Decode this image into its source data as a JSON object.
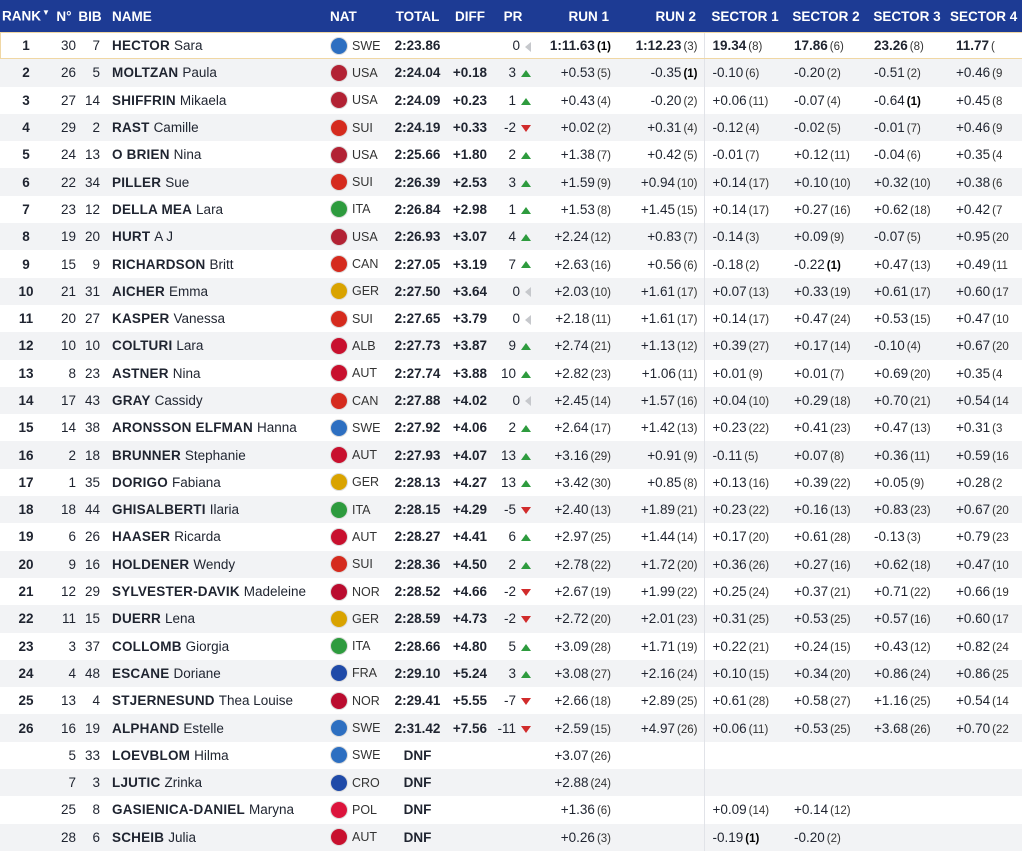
{
  "columns": {
    "rank": "RANK",
    "no": "N°",
    "bib": "BIB",
    "name": "NAME",
    "nat": "NAT",
    "total": "TOTAL",
    "diff": "DIFF",
    "pr": "PR",
    "run1": "RUN 1",
    "run2": "RUN 2",
    "s1": "SECTOR 1",
    "s2": "SECTOR 2",
    "s3": "SECTOR 3",
    "s4": "SECTOR 4"
  },
  "flag_colors": {
    "SWE": "#2d6fc1",
    "USA": "#b22234",
    "SUI": "#d52b1e",
    "CAN": "#d52b1e",
    "ITA": "#2e9b3e",
    "GER": "#d9a300",
    "ALB": "#c8102e",
    "AUT": "#c8102e",
    "NOR": "#ba0c2f",
    "FRA": "#1f4aa8",
    "CRO": "#1f4aa8",
    "POL": "#dc143c"
  },
  "rows": [
    {
      "rank": "1",
      "no": "30",
      "bib": "7",
      "last": "HECTOR",
      "first": "Sara",
      "nat": "SWE",
      "total": "2:23.86",
      "diff": "",
      "pr": "0",
      "dir": "eq",
      "run1": "1:11.63",
      "run1_rk": "(1)",
      "run2": "1:12.23",
      "run2_rk": "(3)",
      "s1": "19.34",
      "s1_rk": "(8)",
      "s2": "17.86",
      "s2_rk": "(6)",
      "s3": "23.26",
      "s3_rk": "(8)",
      "s4": "11.77",
      "s4_rk": "(",
      "leader": true
    },
    {
      "rank": "2",
      "no": "26",
      "bib": "5",
      "last": "MOLTZAN",
      "first": "Paula",
      "nat": "USA",
      "total": "2:24.04",
      "diff": "+0.18",
      "pr": "3",
      "dir": "up",
      "run1": "+0.53",
      "run1_rk": "(5)",
      "run2": "-0.35",
      "run2_rk": "(1)",
      "s1": "-0.10",
      "s1_rk": "(6)",
      "s2": "-0.20",
      "s2_rk": "(2)",
      "s3": "-0.51",
      "s3_rk": "(2)",
      "s4": "+0.46",
      "s4_rk": "(9"
    },
    {
      "rank": "3",
      "no": "27",
      "bib": "14",
      "last": "SHIFFRIN",
      "first": "Mikaela",
      "nat": "USA",
      "total": "2:24.09",
      "diff": "+0.23",
      "pr": "1",
      "dir": "up",
      "run1": "+0.43",
      "run1_rk": "(4)",
      "run2": "-0.20",
      "run2_rk": "(2)",
      "s1": "+0.06",
      "s1_rk": "(11)",
      "s2": "-0.07",
      "s2_rk": "(4)",
      "s3": "-0.64",
      "s3_rk": "(1)",
      "s4": "+0.45",
      "s4_rk": "(8"
    },
    {
      "rank": "4",
      "no": "29",
      "bib": "2",
      "last": "RAST",
      "first": "Camille",
      "nat": "SUI",
      "total": "2:24.19",
      "diff": "+0.33",
      "pr": "-2",
      "dir": "down",
      "run1": "+0.02",
      "run1_rk": "(2)",
      "run2": "+0.31",
      "run2_rk": "(4)",
      "s1": "-0.12",
      "s1_rk": "(4)",
      "s2": "-0.02",
      "s2_rk": "(5)",
      "s3": "-0.01",
      "s3_rk": "(7)",
      "s4": "+0.46",
      "s4_rk": "(9"
    },
    {
      "rank": "5",
      "no": "24",
      "bib": "13",
      "last": "O BRIEN",
      "first": "Nina",
      "nat": "USA",
      "total": "2:25.66",
      "diff": "+1.80",
      "pr": "2",
      "dir": "up",
      "run1": "+1.38",
      "run1_rk": "(7)",
      "run2": "+0.42",
      "run2_rk": "(5)",
      "s1": "-0.01",
      "s1_rk": "(7)",
      "s2": "+0.12",
      "s2_rk": "(11)",
      "s3": "-0.04",
      "s3_rk": "(6)",
      "s4": "+0.35",
      "s4_rk": "(4"
    },
    {
      "rank": "6",
      "no": "22",
      "bib": "34",
      "last": "PILLER",
      "first": "Sue",
      "nat": "SUI",
      "total": "2:26.39",
      "diff": "+2.53",
      "pr": "3",
      "dir": "up",
      "run1": "+1.59",
      "run1_rk": "(9)",
      "run2": "+0.94",
      "run2_rk": "(10)",
      "s1": "+0.14",
      "s1_rk": "(17)",
      "s2": "+0.10",
      "s2_rk": "(10)",
      "s3": "+0.32",
      "s3_rk": "(10)",
      "s4": "+0.38",
      "s4_rk": "(6"
    },
    {
      "rank": "7",
      "no": "23",
      "bib": "12",
      "last": "DELLA MEA",
      "first": "Lara",
      "nat": "ITA",
      "total": "2:26.84",
      "diff": "+2.98",
      "pr": "1",
      "dir": "up",
      "run1": "+1.53",
      "run1_rk": "(8)",
      "run2": "+1.45",
      "run2_rk": "(15)",
      "s1": "+0.14",
      "s1_rk": "(17)",
      "s2": "+0.27",
      "s2_rk": "(16)",
      "s3": "+0.62",
      "s3_rk": "(18)",
      "s4": "+0.42",
      "s4_rk": "(7"
    },
    {
      "rank": "8",
      "no": "19",
      "bib": "20",
      "last": "HURT",
      "first": "A J",
      "nat": "USA",
      "total": "2:26.93",
      "diff": "+3.07",
      "pr": "4",
      "dir": "up",
      "run1": "+2.24",
      "run1_rk": "(12)",
      "run2": "+0.83",
      "run2_rk": "(7)",
      "s1": "-0.14",
      "s1_rk": "(3)",
      "s2": "+0.09",
      "s2_rk": "(9)",
      "s3": "-0.07",
      "s3_rk": "(5)",
      "s4": "+0.95",
      "s4_rk": "(20"
    },
    {
      "rank": "9",
      "no": "15",
      "bib": "9",
      "last": "RICHARDSON",
      "first": "Britt",
      "nat": "CAN",
      "total": "2:27.05",
      "diff": "+3.19",
      "pr": "7",
      "dir": "up",
      "run1": "+2.63",
      "run1_rk": "(16)",
      "run2": "+0.56",
      "run2_rk": "(6)",
      "s1": "-0.18",
      "s1_rk": "(2)",
      "s2": "-0.22",
      "s2_rk": "(1)",
      "s3": "+0.47",
      "s3_rk": "(13)",
      "s4": "+0.49",
      "s4_rk": "(11"
    },
    {
      "rank": "10",
      "no": "21",
      "bib": "31",
      "last": "AICHER",
      "first": "Emma",
      "nat": "GER",
      "total": "2:27.50",
      "diff": "+3.64",
      "pr": "0",
      "dir": "eq",
      "run1": "+2.03",
      "run1_rk": "(10)",
      "run2": "+1.61",
      "run2_rk": "(17)",
      "s1": "+0.07",
      "s1_rk": "(13)",
      "s2": "+0.33",
      "s2_rk": "(19)",
      "s3": "+0.61",
      "s3_rk": "(17)",
      "s4": "+0.60",
      "s4_rk": "(17"
    },
    {
      "rank": "11",
      "no": "20",
      "bib": "27",
      "last": "KASPER",
      "first": "Vanessa",
      "nat": "SUI",
      "total": "2:27.65",
      "diff": "+3.79",
      "pr": "0",
      "dir": "eq",
      "run1": "+2.18",
      "run1_rk": "(11)",
      "run2": "+1.61",
      "run2_rk": "(17)",
      "s1": "+0.14",
      "s1_rk": "(17)",
      "s2": "+0.47",
      "s2_rk": "(24)",
      "s3": "+0.53",
      "s3_rk": "(15)",
      "s4": "+0.47",
      "s4_rk": "(10"
    },
    {
      "rank": "12",
      "no": "10",
      "bib": "10",
      "last": "COLTURI",
      "first": "Lara",
      "nat": "ALB",
      "total": "2:27.73",
      "diff": "+3.87",
      "pr": "9",
      "dir": "up",
      "run1": "+2.74",
      "run1_rk": "(21)",
      "run2": "+1.13",
      "run2_rk": "(12)",
      "s1": "+0.39",
      "s1_rk": "(27)",
      "s2": "+0.17",
      "s2_rk": "(14)",
      "s3": "-0.10",
      "s3_rk": "(4)",
      "s4": "+0.67",
      "s4_rk": "(20"
    },
    {
      "rank": "13",
      "no": "8",
      "bib": "23",
      "last": "ASTNER",
      "first": "Nina",
      "nat": "AUT",
      "total": "2:27.74",
      "diff": "+3.88",
      "pr": "10",
      "dir": "up",
      "run1": "+2.82",
      "run1_rk": "(23)",
      "run2": "+1.06",
      "run2_rk": "(11)",
      "s1": "+0.01",
      "s1_rk": "(9)",
      "s2": "+0.01",
      "s2_rk": "(7)",
      "s3": "+0.69",
      "s3_rk": "(20)",
      "s4": "+0.35",
      "s4_rk": "(4"
    },
    {
      "rank": "14",
      "no": "17",
      "bib": "43",
      "last": "GRAY",
      "first": "Cassidy",
      "nat": "CAN",
      "total": "2:27.88",
      "diff": "+4.02",
      "pr": "0",
      "dir": "eq",
      "run1": "+2.45",
      "run1_rk": "(14)",
      "run2": "+1.57",
      "run2_rk": "(16)",
      "s1": "+0.04",
      "s1_rk": "(10)",
      "s2": "+0.29",
      "s2_rk": "(18)",
      "s3": "+0.70",
      "s3_rk": "(21)",
      "s4": "+0.54",
      "s4_rk": "(14"
    },
    {
      "rank": "15",
      "no": "14",
      "bib": "38",
      "last": "ARONSSON ELFMAN",
      "first": "Hanna",
      "nat": "SWE",
      "total": "2:27.92",
      "diff": "+4.06",
      "pr": "2",
      "dir": "up",
      "run1": "+2.64",
      "run1_rk": "(17)",
      "run2": "+1.42",
      "run2_rk": "(13)",
      "s1": "+0.23",
      "s1_rk": "(22)",
      "s2": "+0.41",
      "s2_rk": "(23)",
      "s3": "+0.47",
      "s3_rk": "(13)",
      "s4": "+0.31",
      "s4_rk": "(3"
    },
    {
      "rank": "16",
      "no": "2",
      "bib": "18",
      "last": "BRUNNER",
      "first": "Stephanie",
      "nat": "AUT",
      "total": "2:27.93",
      "diff": "+4.07",
      "pr": "13",
      "dir": "up",
      "run1": "+3.16",
      "run1_rk": "(29)",
      "run2": "+0.91",
      "run2_rk": "(9)",
      "s1": "-0.11",
      "s1_rk": "(5)",
      "s2": "+0.07",
      "s2_rk": "(8)",
      "s3": "+0.36",
      "s3_rk": "(11)",
      "s4": "+0.59",
      "s4_rk": "(16"
    },
    {
      "rank": "17",
      "no": "1",
      "bib": "35",
      "last": "DORIGO",
      "first": "Fabiana",
      "nat": "GER",
      "total": "2:28.13",
      "diff": "+4.27",
      "pr": "13",
      "dir": "up",
      "run1": "+3.42",
      "run1_rk": "(30)",
      "run2": "+0.85",
      "run2_rk": "(8)",
      "s1": "+0.13",
      "s1_rk": "(16)",
      "s2": "+0.39",
      "s2_rk": "(22)",
      "s3": "+0.05",
      "s3_rk": "(9)",
      "s4": "+0.28",
      "s4_rk": "(2"
    },
    {
      "rank": "18",
      "no": "18",
      "bib": "44",
      "last": "GHISALBERTI",
      "first": "Ilaria",
      "nat": "ITA",
      "total": "2:28.15",
      "diff": "+4.29",
      "pr": "-5",
      "dir": "down",
      "run1": "+2.40",
      "run1_rk": "(13)",
      "run2": "+1.89",
      "run2_rk": "(21)",
      "s1": "+0.23",
      "s1_rk": "(22)",
      "s2": "+0.16",
      "s2_rk": "(13)",
      "s3": "+0.83",
      "s3_rk": "(23)",
      "s4": "+0.67",
      "s4_rk": "(20"
    },
    {
      "rank": "19",
      "no": "6",
      "bib": "26",
      "last": "HAASER",
      "first": "Ricarda",
      "nat": "AUT",
      "total": "2:28.27",
      "diff": "+4.41",
      "pr": "6",
      "dir": "up",
      "run1": "+2.97",
      "run1_rk": "(25)",
      "run2": "+1.44",
      "run2_rk": "(14)",
      "s1": "+0.17",
      "s1_rk": "(20)",
      "s2": "+0.61",
      "s2_rk": "(28)",
      "s3": "-0.13",
      "s3_rk": "(3)",
      "s4": "+0.79",
      "s4_rk": "(23"
    },
    {
      "rank": "20",
      "no": "9",
      "bib": "16",
      "last": "HOLDENER",
      "first": "Wendy",
      "nat": "SUI",
      "total": "2:28.36",
      "diff": "+4.50",
      "pr": "2",
      "dir": "up",
      "run1": "+2.78",
      "run1_rk": "(22)",
      "run2": "+1.72",
      "run2_rk": "(20)",
      "s1": "+0.36",
      "s1_rk": "(26)",
      "s2": "+0.27",
      "s2_rk": "(16)",
      "s3": "+0.62",
      "s3_rk": "(18)",
      "s4": "+0.47",
      "s4_rk": "(10"
    },
    {
      "rank": "21",
      "no": "12",
      "bib": "29",
      "last": "SYLVESTER-DAVIK",
      "first": "Madeleine",
      "nat": "NOR",
      "total": "2:28.52",
      "diff": "+4.66",
      "pr": "-2",
      "dir": "down",
      "run1": "+2.67",
      "run1_rk": "(19)",
      "run2": "+1.99",
      "run2_rk": "(22)",
      "s1": "+0.25",
      "s1_rk": "(24)",
      "s2": "+0.37",
      "s2_rk": "(21)",
      "s3": "+0.71",
      "s3_rk": "(22)",
      "s4": "+0.66",
      "s4_rk": "(19"
    },
    {
      "rank": "22",
      "no": "11",
      "bib": "15",
      "last": "DUERR",
      "first": "Lena",
      "nat": "GER",
      "total": "2:28.59",
      "diff": "+4.73",
      "pr": "-2",
      "dir": "down",
      "run1": "+2.72",
      "run1_rk": "(20)",
      "run2": "+2.01",
      "run2_rk": "(23)",
      "s1": "+0.31",
      "s1_rk": "(25)",
      "s2": "+0.53",
      "s2_rk": "(25)",
      "s3": "+0.57",
      "s3_rk": "(16)",
      "s4": "+0.60",
      "s4_rk": "(17"
    },
    {
      "rank": "23",
      "no": "3",
      "bib": "37",
      "last": "COLLOMB",
      "first": "Giorgia",
      "nat": "ITA",
      "total": "2:28.66",
      "diff": "+4.80",
      "pr": "5",
      "dir": "up",
      "run1": "+3.09",
      "run1_rk": "(28)",
      "run2": "+1.71",
      "run2_rk": "(19)",
      "s1": "+0.22",
      "s1_rk": "(21)",
      "s2": "+0.24",
      "s2_rk": "(15)",
      "s3": "+0.43",
      "s3_rk": "(12)",
      "s4": "+0.82",
      "s4_rk": "(24"
    },
    {
      "rank": "24",
      "no": "4",
      "bib": "48",
      "last": "ESCANE",
      "first": "Doriane",
      "nat": "FRA",
      "total": "2:29.10",
      "diff": "+5.24",
      "pr": "3",
      "dir": "up",
      "run1": "+3.08",
      "run1_rk": "(27)",
      "run2": "+2.16",
      "run2_rk": "(24)",
      "s1": "+0.10",
      "s1_rk": "(15)",
      "s2": "+0.34",
      "s2_rk": "(20)",
      "s3": "+0.86",
      "s3_rk": "(24)",
      "s4": "+0.86",
      "s4_rk": "(25"
    },
    {
      "rank": "25",
      "no": "13",
      "bib": "4",
      "last": "STJERNESUND",
      "first": "Thea Louise",
      "nat": "NOR",
      "total": "2:29.41",
      "diff": "+5.55",
      "pr": "-7",
      "dir": "down",
      "run1": "+2.66",
      "run1_rk": "(18)",
      "run2": "+2.89",
      "run2_rk": "(25)",
      "s1": "+0.61",
      "s1_rk": "(28)",
      "s2": "+0.58",
      "s2_rk": "(27)",
      "s3": "+1.16",
      "s3_rk": "(25)",
      "s4": "+0.54",
      "s4_rk": "(14"
    },
    {
      "rank": "26",
      "no": "16",
      "bib": "19",
      "last": "ALPHAND",
      "first": "Estelle",
      "nat": "SWE",
      "total": "2:31.42",
      "diff": "+7.56",
      "pr": "-11",
      "dir": "down",
      "run1": "+2.59",
      "run1_rk": "(15)",
      "run2": "+4.97",
      "run2_rk": "(26)",
      "s1": "+0.06",
      "s1_rk": "(11)",
      "s2": "+0.53",
      "s2_rk": "(25)",
      "s3": "+3.68",
      "s3_rk": "(26)",
      "s4": "+0.70",
      "s4_rk": "(22"
    },
    {
      "rank": "",
      "no": "5",
      "bib": "33",
      "last": "LOEVBLOM",
      "first": "Hilma",
      "nat": "SWE",
      "total": "DNF",
      "diff": "",
      "pr": "",
      "dir": "",
      "run1": "+3.07",
      "run1_rk": "(26)",
      "run2": "",
      "run2_rk": "",
      "s1": "",
      "s1_rk": "",
      "s2": "",
      "s2_rk": "",
      "s3": "",
      "s3_rk": "",
      "s4": "",
      "s4_rk": ""
    },
    {
      "rank": "",
      "no": "7",
      "bib": "3",
      "last": "LJUTIC",
      "first": "Zrinka",
      "nat": "CRO",
      "total": "DNF",
      "diff": "",
      "pr": "",
      "dir": "",
      "run1": "+2.88",
      "run1_rk": "(24)",
      "run2": "",
      "run2_rk": "",
      "s1": "",
      "s1_rk": "",
      "s2": "",
      "s2_rk": "",
      "s3": "",
      "s3_rk": "",
      "s4": "",
      "s4_rk": ""
    },
    {
      "rank": "",
      "no": "25",
      "bib": "8",
      "last": "GASIENICA-DANIEL",
      "first": "Maryna",
      "nat": "POL",
      "total": "DNF",
      "diff": "",
      "pr": "",
      "dir": "",
      "run1": "+1.36",
      "run1_rk": "(6)",
      "run2": "",
      "run2_rk": "",
      "s1": "+0.09",
      "s1_rk": "(14)",
      "s2": "+0.14",
      "s2_rk": "(12)",
      "s3": "",
      "s3_rk": "",
      "s4": "",
      "s4_rk": ""
    },
    {
      "rank": "",
      "no": "28",
      "bib": "6",
      "last": "SCHEIB",
      "first": "Julia",
      "nat": "AUT",
      "total": "DNF",
      "diff": "",
      "pr": "",
      "dir": "",
      "run1": "+0.26",
      "run1_rk": "(3)",
      "run2": "",
      "run2_rk": "",
      "s1": "-0.19",
      "s1_rk": "(1)",
      "s2": "-0.20",
      "s2_rk": "(2)",
      "s3": "",
      "s3_rk": "",
      "s4": "",
      "s4_rk": ""
    }
  ]
}
